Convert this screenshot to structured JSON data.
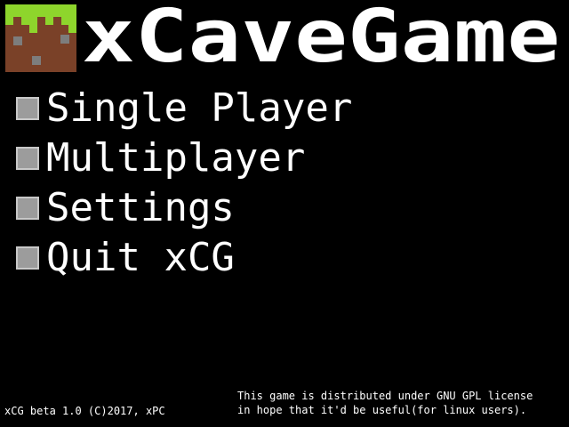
{
  "title": "xCaveGame",
  "logo": {
    "icon": "grass-dirt-block-icon"
  },
  "menu": [
    {
      "label": "Single Player",
      "icon": "checkbox-icon"
    },
    {
      "label": "Multiplayer",
      "icon": "checkbox-icon"
    },
    {
      "label": "Settings",
      "icon": "checkbox-icon"
    },
    {
      "label": "Quit xCG",
      "icon": "checkbox-icon"
    }
  ],
  "footer": {
    "version": "xCG beta 1.0 (C)2017, xPC",
    "license_line1": "This game is distributed under GNU GPL license",
    "license_line2": "in hope that it'd be useful(for linux users)."
  },
  "colors": {
    "background": "#000000",
    "text": "#ffffff",
    "grass": "#8ed52c",
    "dirt": "#7a4128",
    "stone_speck": "#7d7d7d",
    "checkbox_fill": "#9c9c9c",
    "checkbox_border": "#c8c8c8"
  }
}
